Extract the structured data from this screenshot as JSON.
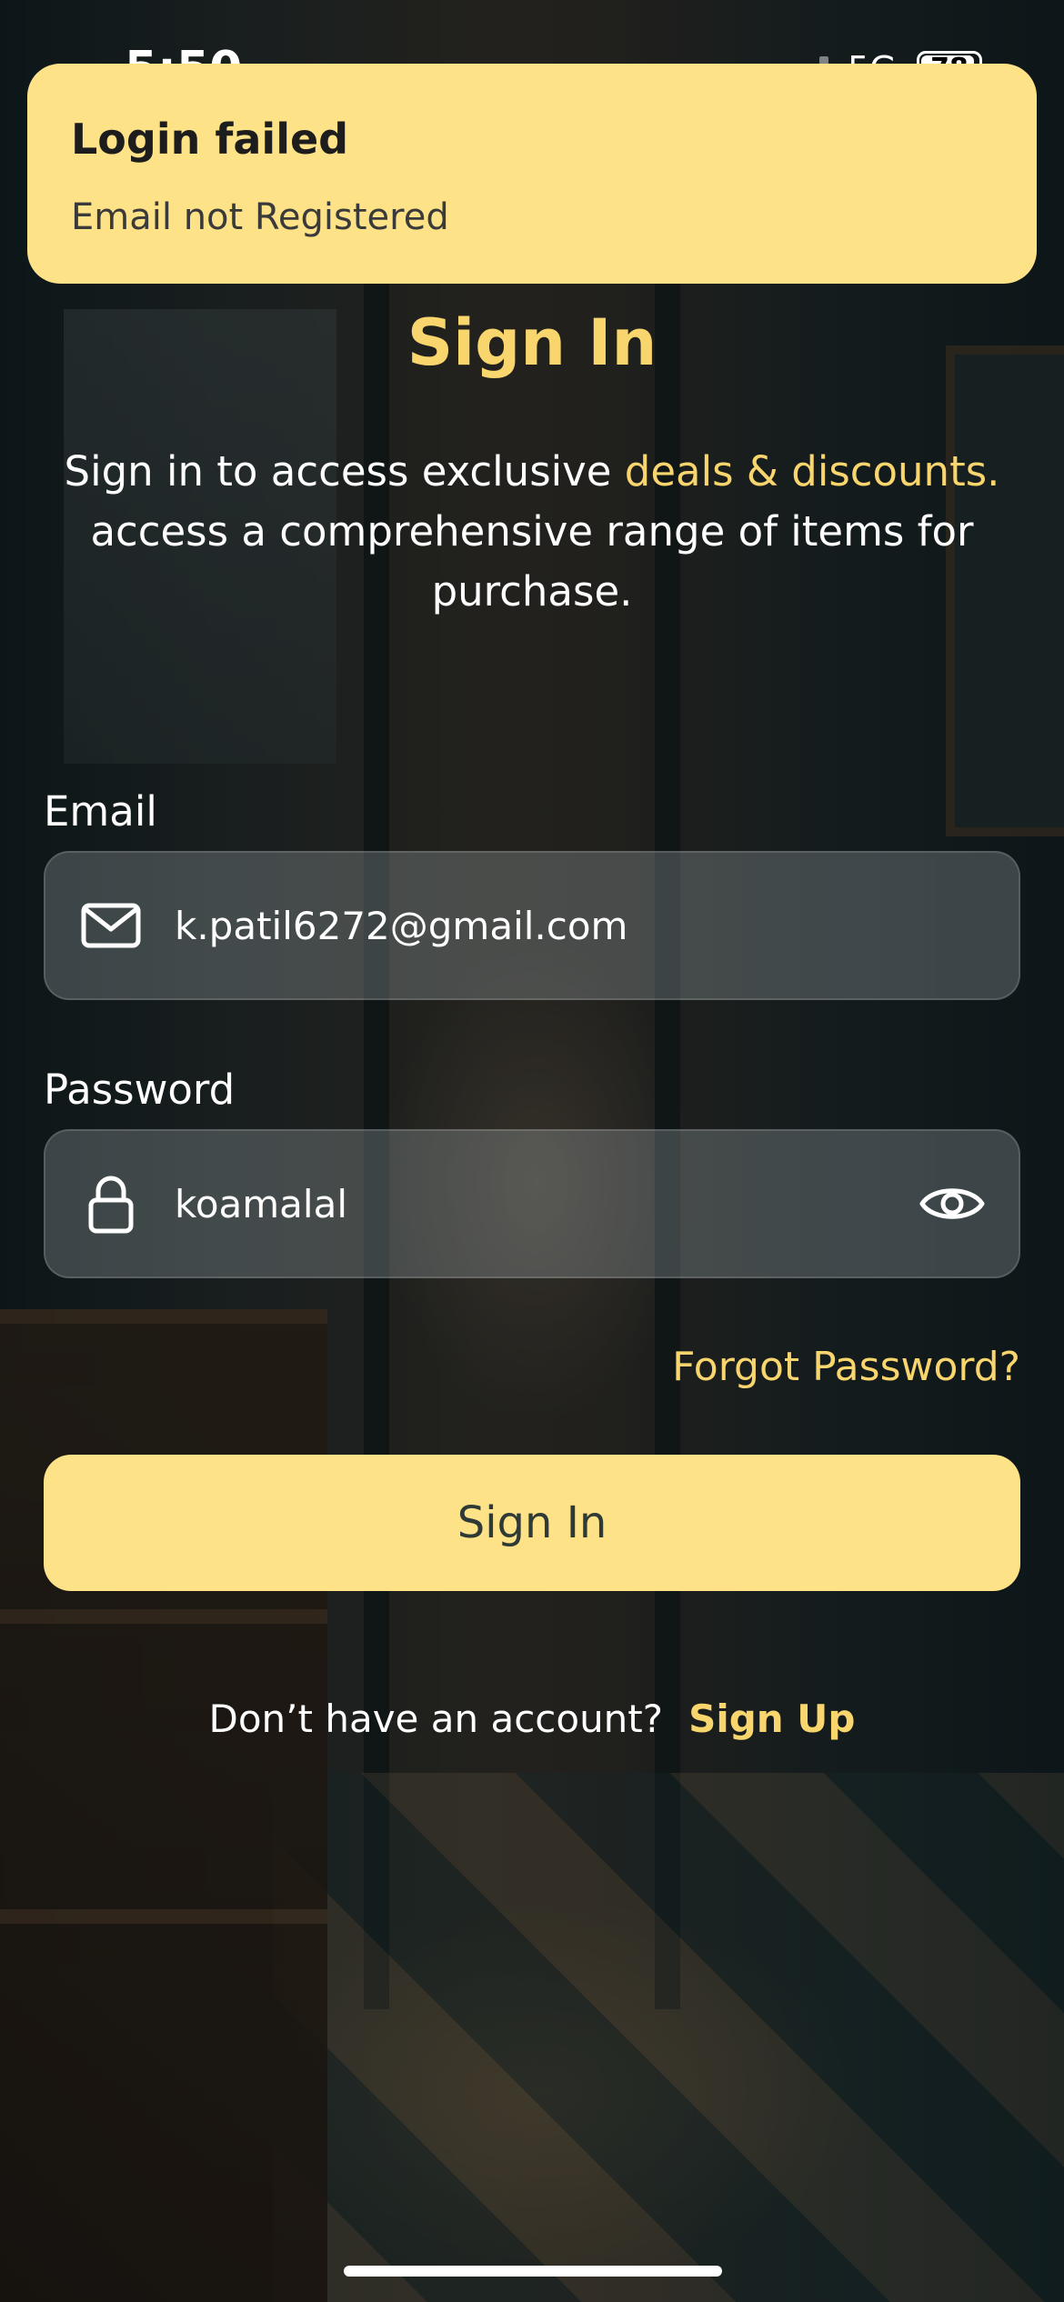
{
  "status_bar": {
    "time": "5:50",
    "network": "5G",
    "battery": "78"
  },
  "toast": {
    "title": "Login failed",
    "message": "Email not Registered"
  },
  "header": {
    "title": "Sign In",
    "subtitle_part1": "Sign in to access exclusive ",
    "subtitle_highlight": "deals & discounts.",
    "subtitle_part2": " access a comprehensive range of items for purchase."
  },
  "email": {
    "label": "Email",
    "value": "k.patil6272@gmail.com",
    "icon": "mail-icon"
  },
  "password": {
    "label": "Password",
    "value": "koamalal",
    "icon": "lock-icon",
    "toggle_icon": "eye-icon"
  },
  "forgot_label": "Forgot Password?",
  "signin_label": "Sign In",
  "signup": {
    "question": "Don’t have an account?",
    "link": "Sign Up"
  },
  "colors": {
    "accent": "#fde288",
    "accent_text": "#f9d56e"
  }
}
